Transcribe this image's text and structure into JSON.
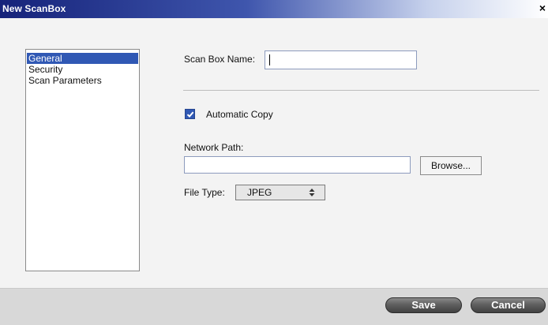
{
  "window": {
    "title": "New ScanBox",
    "close_glyph": "×"
  },
  "sidebar": {
    "items": [
      {
        "label": "General",
        "selected": true
      },
      {
        "label": "Security",
        "selected": false
      },
      {
        "label": "Scan Parameters",
        "selected": false
      }
    ]
  },
  "form": {
    "scan_box_name_label": "Scan Box Name:",
    "scan_box_name_value": "",
    "automatic_copy_label": "Automatic Copy",
    "automatic_copy_checked": true,
    "network_path_label": "Network Path:",
    "network_path_value": "",
    "browse_label": "Browse...",
    "file_type_label": "File Type:",
    "file_type_value": "JPEG"
  },
  "footer": {
    "save_label": "Save",
    "cancel_label": "Cancel"
  },
  "colors": {
    "selection": "#3058b4",
    "titlebar_dark": "#16237a",
    "button_dark": "#414141"
  }
}
